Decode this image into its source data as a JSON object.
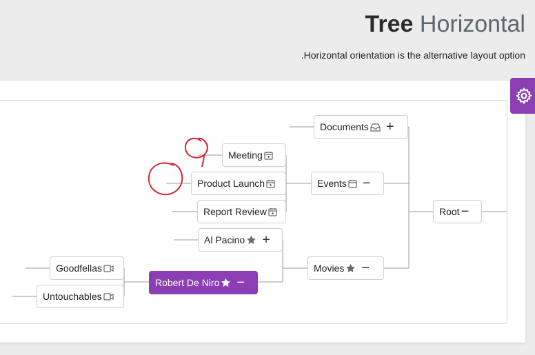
{
  "header": {
    "title_bold": "Tree",
    "title_light": "Horizontal",
    "subtitle": ".Horizontal orientation is the alternative layout option"
  },
  "toolbar": {
    "settings_icon": "gear-icon"
  },
  "tree": {
    "root": {
      "label": "Root",
      "toggle": "−"
    },
    "documents": {
      "label": "Documents",
      "icon": "inbox-icon",
      "toggle": "+"
    },
    "events": {
      "label": "Events",
      "icon": "calendar-icon",
      "toggle": "−"
    },
    "meeting": {
      "label": "Meeting",
      "icon": "calendar-icon"
    },
    "product_launch": {
      "label": "Product Launch",
      "icon": "calendar-icon"
    },
    "report_review": {
      "label": "Report Review",
      "icon": "calendar-icon"
    },
    "movies": {
      "label": "Movies",
      "icon": "star-icon",
      "toggle": "−"
    },
    "al_pacino": {
      "label": "Al Pacino",
      "icon": "star-icon",
      "toggle": "+"
    },
    "robert_de_niro": {
      "label": "Robert De Niro",
      "icon": "star-icon",
      "toggle": "−"
    },
    "goodfellas": {
      "label": "Goodfellas",
      "icon": "video-icon"
    },
    "untouchables": {
      "label": "Untouchables",
      "icon": "video-icon"
    }
  },
  "colors": {
    "accent": "#8c3fb5",
    "annotation": "#d9232e"
  }
}
